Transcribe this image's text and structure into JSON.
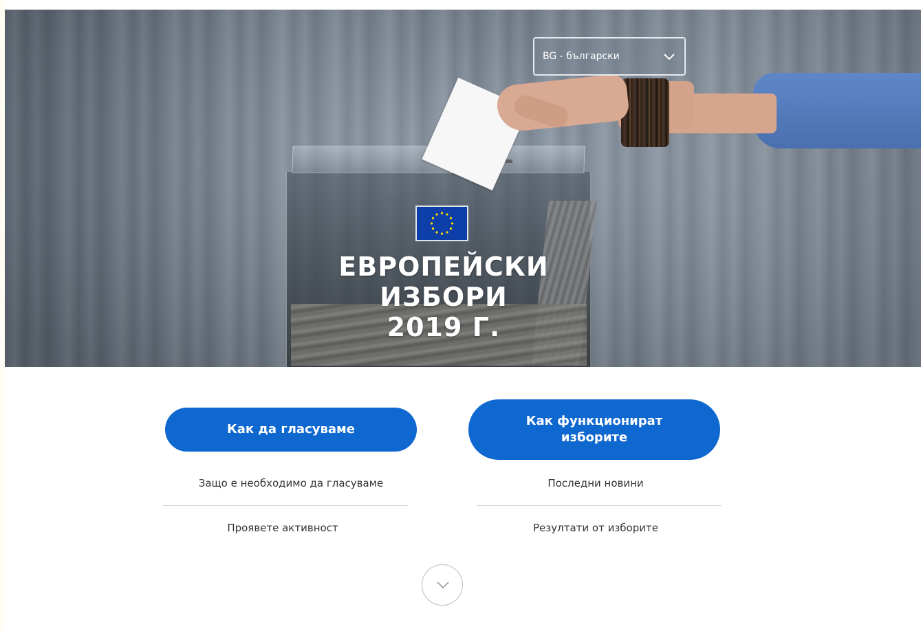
{
  "hero": {
    "title_lines": [
      "ЕВРОПЕЙСКИ",
      "ИЗБОРИ",
      "2019 Г."
    ]
  },
  "language_selector": {
    "selected": "BG - български"
  },
  "actions": {
    "how_to_vote": "Как да гласуваме",
    "how_elections_work": "Как функционират изборите"
  },
  "links": {
    "left": [
      "Защо е необходимо да гласуваме",
      "Проявете активност"
    ],
    "right": [
      "Последни новини",
      "Резултати от изборите"
    ]
  },
  "icons": {
    "scroll": "chevron-down-icon",
    "flag": "eu-flag-icon"
  },
  "colors": {
    "primary_button": "#0f68d0"
  }
}
